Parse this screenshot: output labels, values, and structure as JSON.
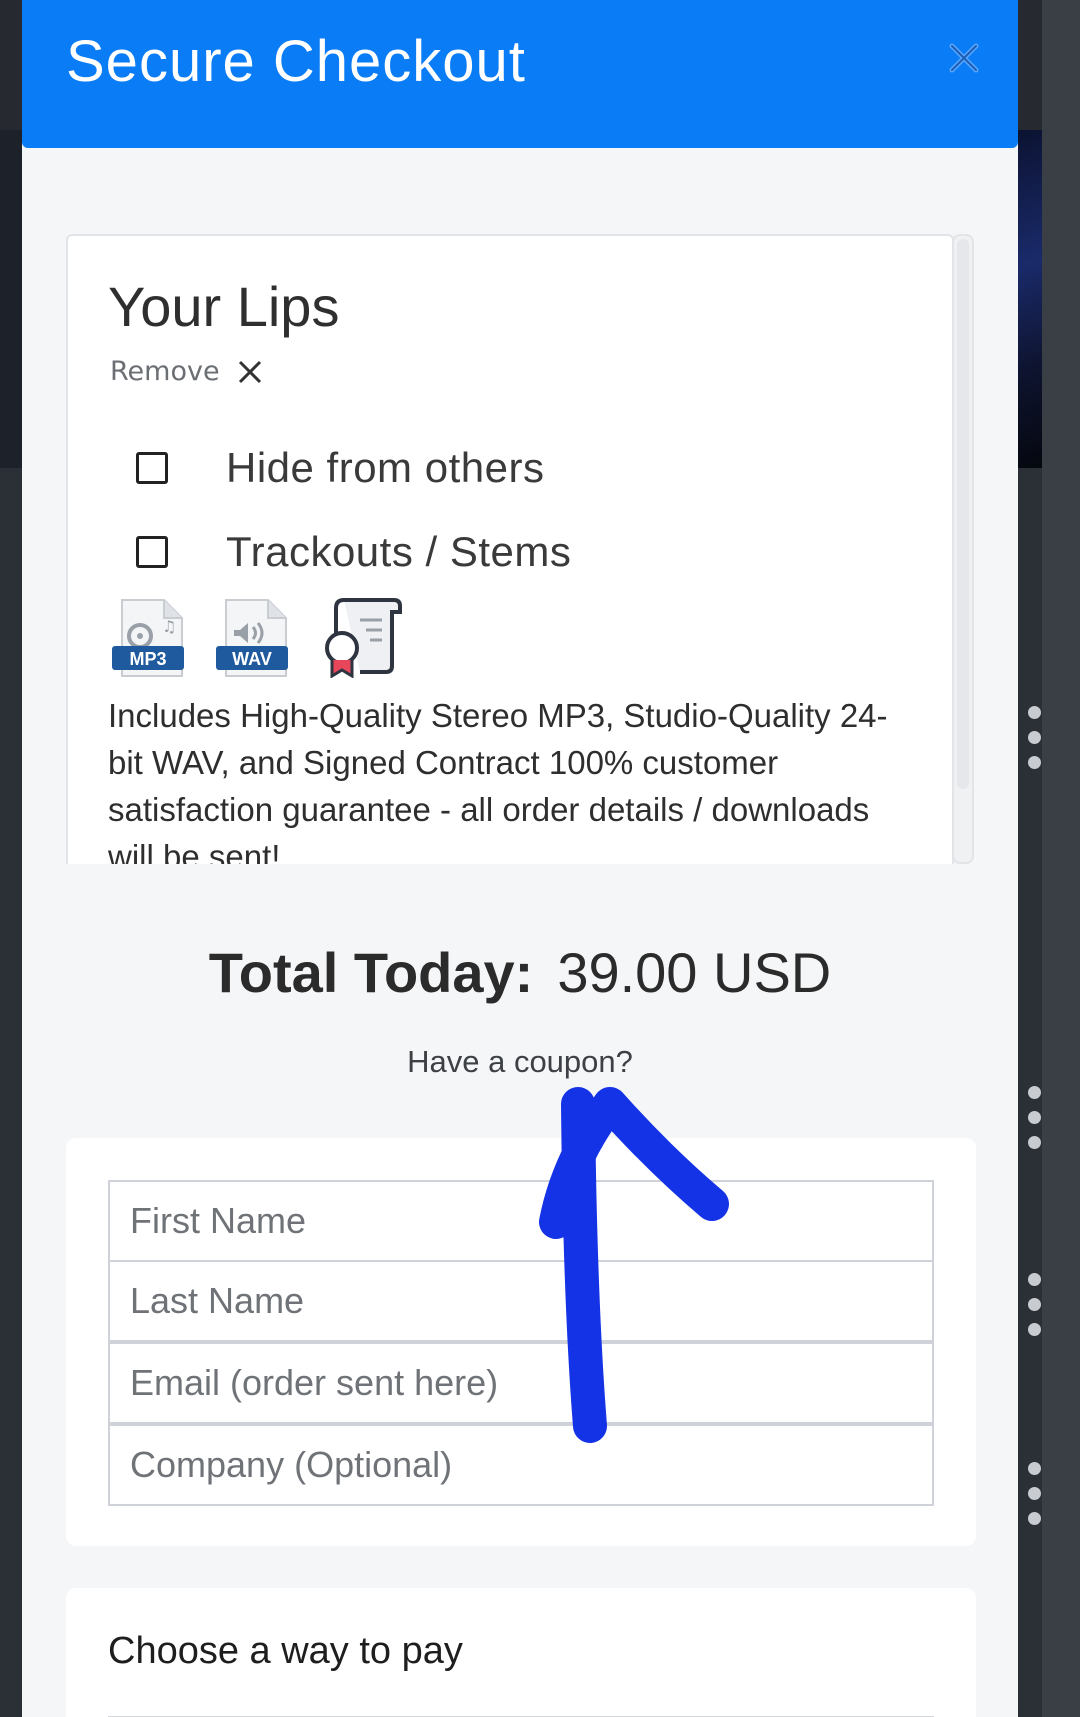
{
  "modal": {
    "title": "Secure Checkout"
  },
  "item": {
    "title": "Your Lips",
    "remove_label": "Remove",
    "options": [
      {
        "label": "Hide from others",
        "checked": false
      },
      {
        "label": "Trackouts / Stems",
        "checked": false
      }
    ],
    "format_icons": [
      {
        "name": "mp3-file-icon",
        "label": "MP3"
      },
      {
        "name": "wav-file-icon",
        "label": "WAV"
      },
      {
        "name": "contract-certificate-icon"
      }
    ],
    "description": "Includes High-Quality Stereo MP3, Studio-Quality 24-bit WAV, and Signed Contract 100% customer satisfaction guarantee - all order details / downloads will be sent!"
  },
  "summary": {
    "total_label": "Total Today:",
    "total_amount": "39.00 USD",
    "coupon_link": "Have a coupon?"
  },
  "form": {
    "first_name_placeholder": "First Name",
    "last_name_placeholder": "Last Name",
    "email_placeholder": "Email (order sent here)",
    "company_placeholder": "Company (Optional)"
  },
  "payment": {
    "title": "Choose a way to pay"
  },
  "colors": {
    "header": "#0a7cf5",
    "annotation_arrow": "#1432e6"
  }
}
